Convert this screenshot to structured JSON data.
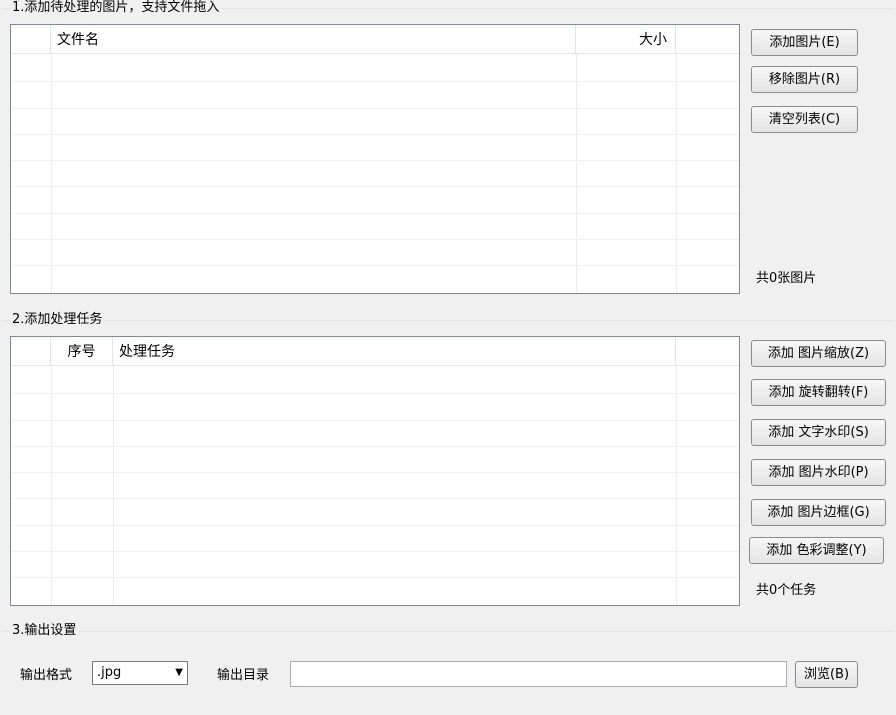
{
  "section1": {
    "title": "1.添加待处理的图片，支持文件拖入",
    "columns": {
      "filename": "文件名",
      "size": "大小"
    },
    "buttons": {
      "add": "添加图片(E)",
      "remove": "移除图片(R)",
      "clear": "清空列表(C)"
    },
    "count": "共0张图片"
  },
  "section2": {
    "title": "2.添加处理任务",
    "columns": {
      "index": "序号",
      "task": "处理任务"
    },
    "buttons": {
      "resize": "添加 图片缩放(Z)",
      "rotate": "添加 旋转翻转(F)",
      "text_watermark": "添加 文字水印(S)",
      "image_watermark": "添加 图片水印(P)",
      "border": "添加 图片边框(G)",
      "color": "添加 色彩调整(Y)"
    },
    "count": "共0个任务"
  },
  "section3": {
    "title": "3.输出设置",
    "format_label": "输出格式",
    "format_value": ".jpg",
    "dir_label": "输出目录",
    "dir_value": "",
    "browse": "浏览(B)"
  }
}
